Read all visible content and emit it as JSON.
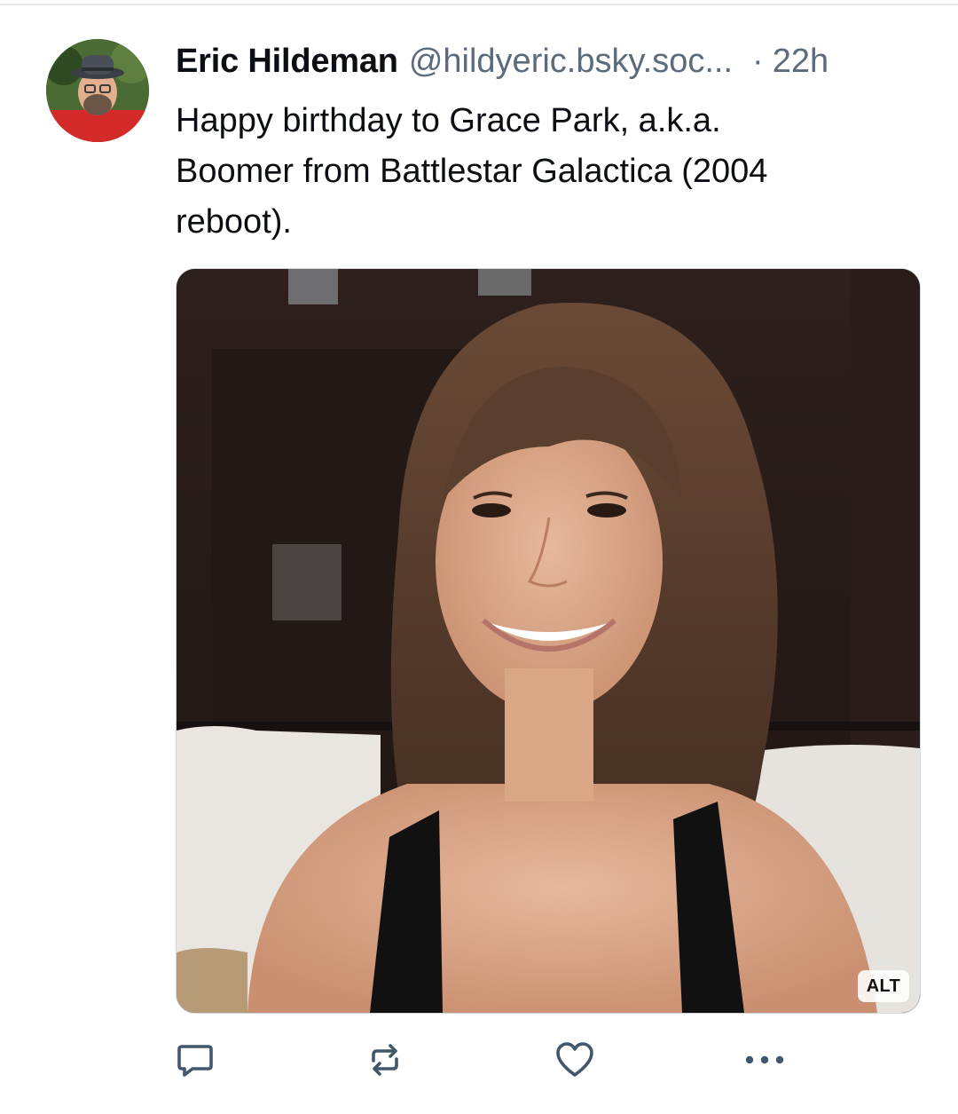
{
  "post": {
    "author_name": "Eric Hildeman",
    "author_handle": "@hildyeric.bsky.soc...",
    "separator": "·",
    "time_ago": "22h",
    "text": "Happy birthday to Grace Park, a.k.a.\nBoomer from Battlestar Galactica (2004\nreboot).",
    "image_alt_badge": "ALT"
  },
  "actions": [
    {
      "name": "reply",
      "icon": "reply-icon"
    },
    {
      "name": "repost",
      "icon": "repost-icon"
    },
    {
      "name": "like",
      "icon": "heart-icon"
    },
    {
      "name": "more",
      "icon": "more-options-icon"
    }
  ],
  "colors": {
    "text": "#0b0f14",
    "secondary_text": "#5b6b7c",
    "icon": "#42576c",
    "divider": "#e4e7eb"
  }
}
